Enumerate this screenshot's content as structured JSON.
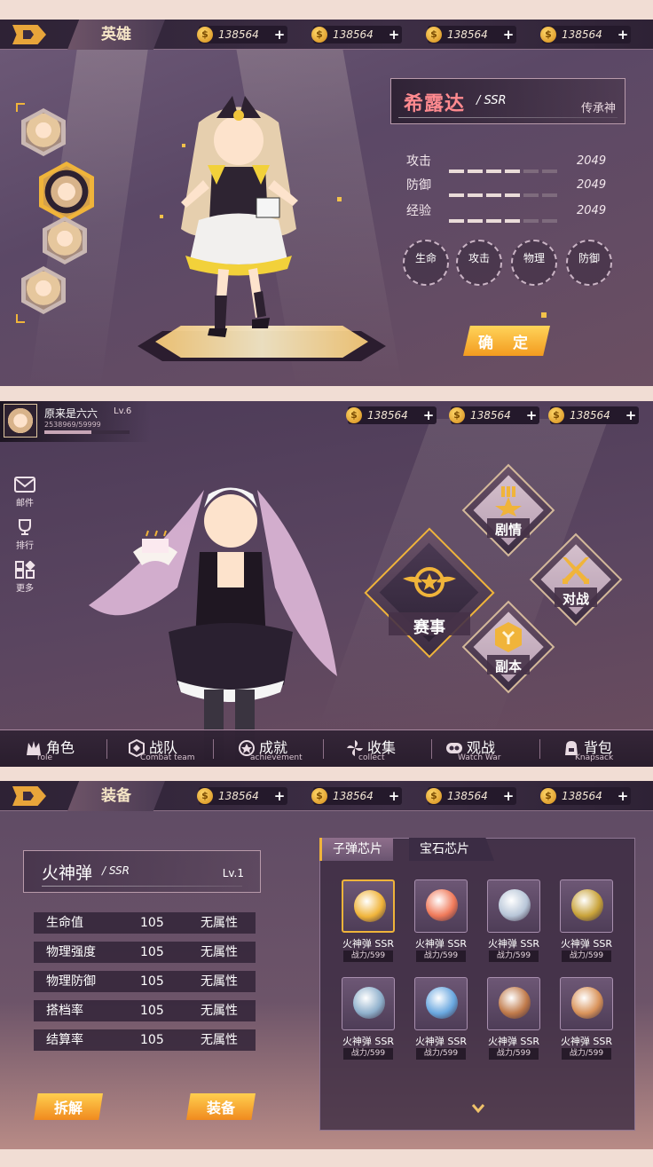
{
  "currency": {
    "icon": "coin-icon",
    "symbol": "$",
    "amount": "138564"
  },
  "hero_screen": {
    "title": "英雄",
    "hero_name": "希露达",
    "rank": "/ SSR",
    "hero_class": "传承神",
    "stats": [
      {
        "label": "攻击",
        "value": "2049",
        "level": 0.72
      },
      {
        "label": "防御",
        "value": "2049",
        "level": 0.72
      },
      {
        "label": "经验",
        "value": "2049",
        "level": 0.72
      }
    ],
    "round_buttons": [
      "生命",
      "攻击",
      "物理",
      "防御"
    ],
    "confirm_label": "确 定"
  },
  "main_screen": {
    "player_name": "原来是六六",
    "player_level": "Lv.6",
    "player_exp": "2538969/59999",
    "exp_fraction": 0.55,
    "side_buttons": [
      {
        "label": "邮件",
        "icon": "mail-icon"
      },
      {
        "label": "排行",
        "icon": "trophy-icon"
      },
      {
        "label": "更多",
        "icon": "more-icon"
      }
    ],
    "modes": [
      {
        "label": "赛事",
        "icon": "star-wings-badge-icon"
      },
      {
        "label": "剧情",
        "icon": "medal-star-icon"
      },
      {
        "label": "对战",
        "icon": "crossed-swords-icon"
      },
      {
        "label": "副本",
        "icon": "hexagon-icon"
      }
    ],
    "nav": [
      {
        "cn": "角色",
        "en": "role",
        "icon": "role-icon"
      },
      {
        "cn": "战队",
        "en": "Combat team",
        "icon": "combat-team-icon"
      },
      {
        "cn": "成就",
        "en": "achievement",
        "icon": "achievement-icon"
      },
      {
        "cn": "收集",
        "en": "collect",
        "icon": "collect-icon"
      },
      {
        "cn": "观战",
        "en": "Watch War",
        "icon": "watch-war-icon"
      },
      {
        "cn": "背包",
        "en": "Knapsack",
        "icon": "knapsack-icon"
      }
    ]
  },
  "equip_screen": {
    "title": "装备",
    "item_name": "火神弹",
    "item_rank": "/ SSR",
    "item_level": "Lv.1",
    "attributes": [
      {
        "name": "生命值",
        "value": "105",
        "type": "无属性"
      },
      {
        "name": "物理强度",
        "value": "105",
        "type": "无属性"
      },
      {
        "name": "物理防御",
        "value": "105",
        "type": "无属性"
      },
      {
        "name": "搭档率",
        "value": "105",
        "type": "无属性"
      },
      {
        "name": "结算率",
        "value": "105",
        "type": "无属性"
      }
    ],
    "tabs": [
      "子弹芯片",
      "宝石芯片"
    ],
    "chips": [
      {
        "name": "火神弹  SSR",
        "power": "战力/599",
        "icon": "golden-swirl-icon",
        "color": "#f0b43a"
      },
      {
        "name": "火神弹  SSR",
        "power": "战力/599",
        "icon": "flame-card-icon",
        "color": "#f07a5a"
      },
      {
        "name": "火神弹  SSR",
        "power": "战力/599",
        "icon": "silver-orb-icon",
        "color": "#b8c6d8"
      },
      {
        "name": "火神弹  SSR",
        "power": "战力/599",
        "icon": "gourd-orb-icon",
        "color": "#c9a33a"
      },
      {
        "name": "火神弹  SSR",
        "power": "战力/599",
        "icon": "treasure-chest-icon",
        "color": "#8fb0cc"
      },
      {
        "name": "火神弹  SSR",
        "power": "战力/599",
        "icon": "blue-key-icon",
        "color": "#6aa8e0"
      },
      {
        "name": "火神弹  SSR",
        "power": "战力/599",
        "icon": "wooden-chest-icon",
        "color": "#c07a4a"
      },
      {
        "name": "火神弹  SSR",
        "power": "战力/599",
        "icon": "bronze-key-icon",
        "color": "#d9935a"
      }
    ],
    "buttons": {
      "disassemble": "拆解",
      "equip": "装备"
    }
  }
}
